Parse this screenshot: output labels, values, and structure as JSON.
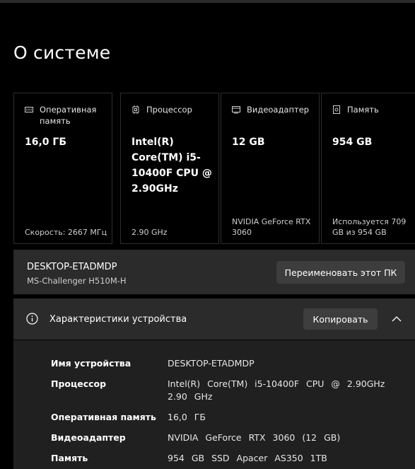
{
  "page": {
    "title": "О системе"
  },
  "cards": [
    {
      "icon": "memory-icon",
      "label": "Оперативная память",
      "value": "16,0 ГБ",
      "footer": "Скорость: 2667 МГц"
    },
    {
      "icon": "cpu-icon",
      "label": "Процессор",
      "value": "Intel(R) Core(TM) i5-10400F CPU @ 2.90GHz",
      "footer": "2.90 GHz"
    },
    {
      "icon": "gpu-icon",
      "label": "Видеоадаптер",
      "value": "12 GB",
      "footer": "NVIDIA GeForce RTX 3060"
    },
    {
      "icon": "storage-icon",
      "label": "Память",
      "value": "954 GB",
      "footer": "Используется 709 GB из 954 GB"
    }
  ],
  "device": {
    "name": "DESKTOP-ETADMDP",
    "model": "MS-Challenger H510M-H",
    "rename_label": "Переименовать этот ПК"
  },
  "specs": {
    "title": "Характеристики устройства",
    "copy_label": "Копировать",
    "rows": [
      {
        "key": "Имя устройства",
        "value": "DESKTOP-ETADMDP"
      },
      {
        "key": "Процессор",
        "value": "Intel(R) Core(TM) i5-10400F CPU @ 2.90GHz 2.90 GHz"
      },
      {
        "key": "Оперативная память",
        "value": "16,0 ГБ"
      },
      {
        "key": "Видеоадаптер",
        "value": "NVIDIA GeForce RTX 3060 (12 GB)"
      },
      {
        "key": "Память",
        "value": "954 GB SSD Apacer AS350 1TB"
      }
    ]
  }
}
